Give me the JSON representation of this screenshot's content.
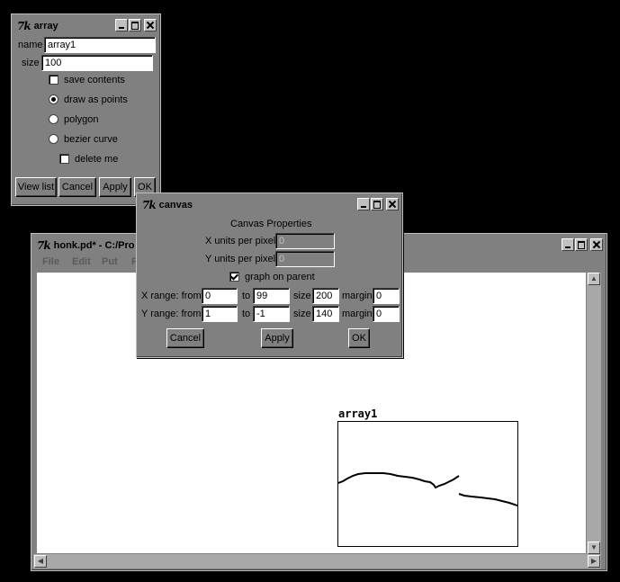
{
  "array_window": {
    "logo": "7k",
    "title": "array",
    "name_label": "name",
    "name_value": "array1",
    "size_label": "size",
    "size_value": "100",
    "save_contents": "save contents",
    "draw_as_points": "draw as points",
    "polygon": "polygon",
    "bezier_curve": "bezier curve",
    "delete_me": "delete me",
    "buttons": {
      "view_list": "View list",
      "cancel": "Cancel",
      "apply": "Apply",
      "ok": "OK"
    }
  },
  "canvas_window": {
    "logo": "7k",
    "title": "canvas",
    "heading": "Canvas Properties",
    "x_units_label": "X units per pixel",
    "x_units_value": "0",
    "y_units_label": "Y units per pixel",
    "y_units_value": "0",
    "graph_on_parent": "graph on parent",
    "x_range": {
      "label": "X range: from",
      "from": "0",
      "to_label": "to",
      "to": "99",
      "size_label": "size",
      "size": "200",
      "margin_label": "margin",
      "margin": "0"
    },
    "y_range": {
      "label": "Y range: from",
      "from": "1",
      "to_label": "to",
      "to": "-1",
      "size_label": "size",
      "size": "140",
      "margin_label": "margin",
      "margin": "0"
    },
    "buttons": {
      "cancel": "Cancel",
      "apply": "Apply",
      "ok": "OK"
    }
  },
  "main_window": {
    "logo": "7k",
    "title": "honk.pd* - C:/Pro",
    "menu": {
      "file": "File",
      "edit": "Edit",
      "put": "Put",
      "find": "F"
    },
    "graph_label": "array1"
  }
}
